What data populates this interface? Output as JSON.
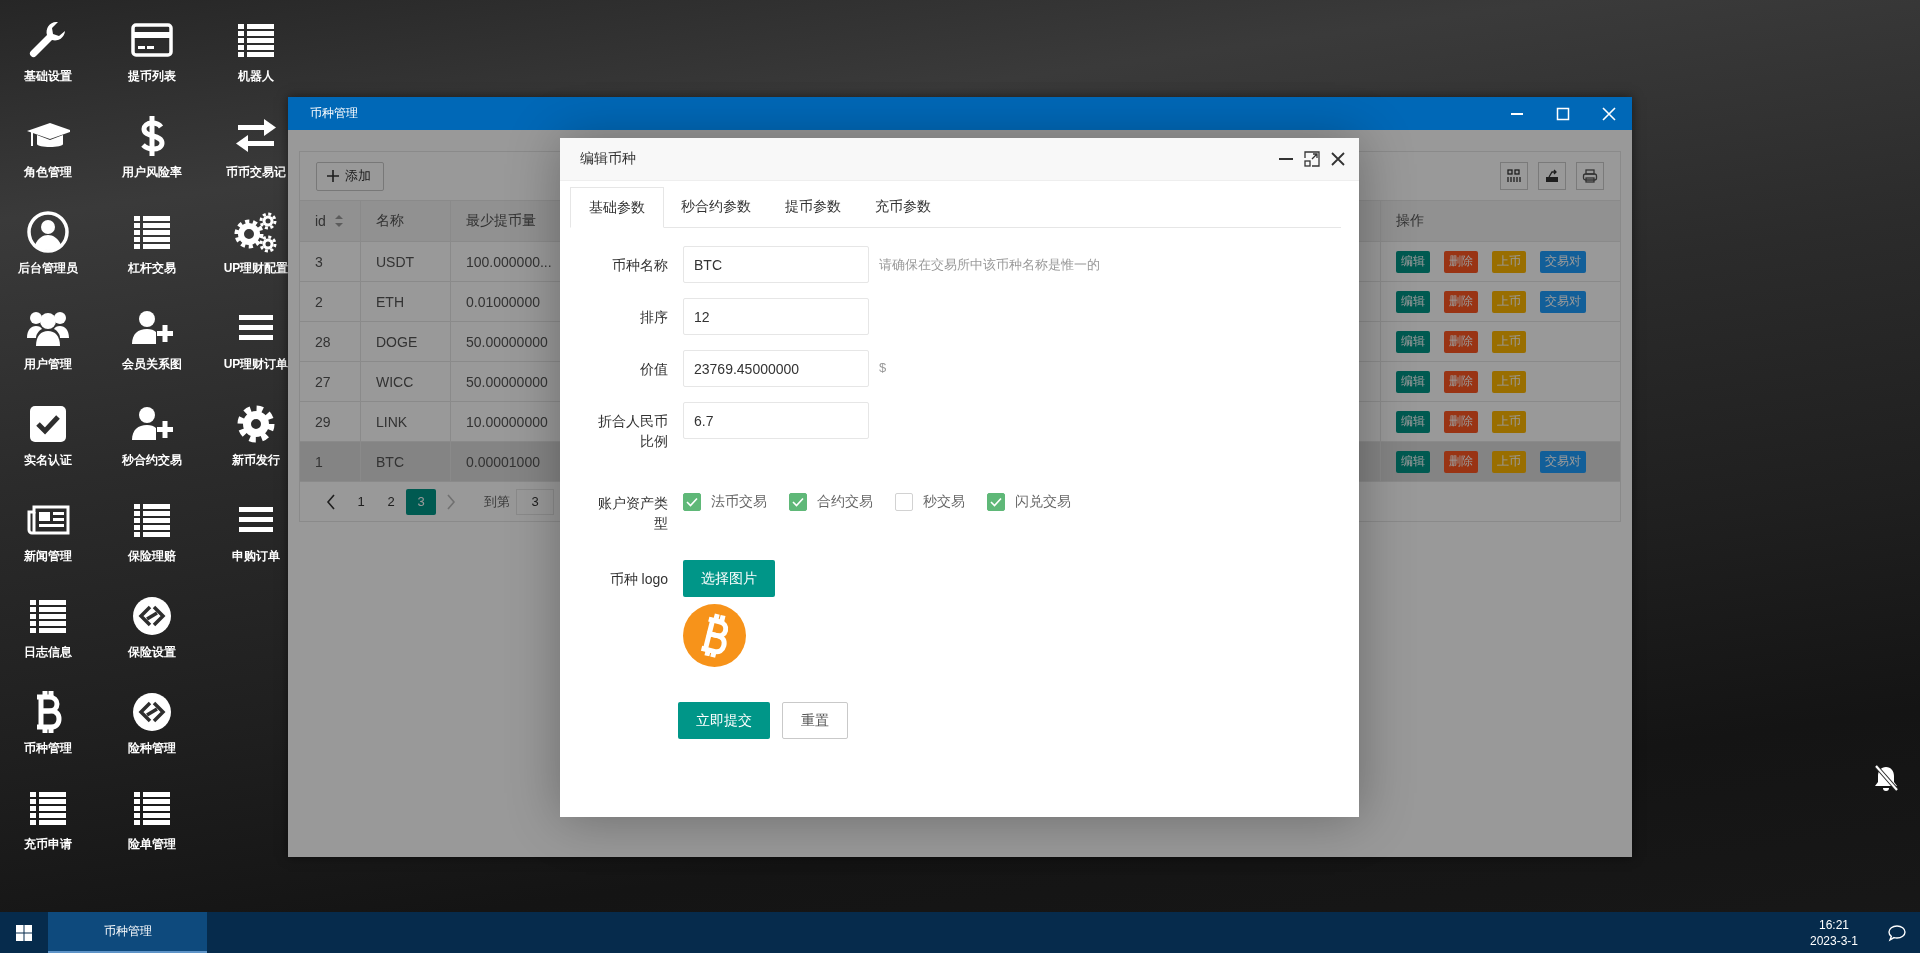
{
  "desktop_icons": [
    {
      "label": "基础设置"
    },
    {
      "label": "角色管理"
    },
    {
      "label": "后台管理员"
    },
    {
      "label": "用户管理"
    },
    {
      "label": "实名认证"
    },
    {
      "label": "新闻管理"
    },
    {
      "label": "日志信息"
    },
    {
      "label": "币种管理"
    },
    {
      "label": "充币申请"
    },
    {
      "label": "提币列表"
    },
    {
      "label": "用户风险率"
    },
    {
      "label": "杠杆交易"
    },
    {
      "label": "会员关系图"
    },
    {
      "label": "秒合约交易"
    },
    {
      "label": "保险理赔"
    },
    {
      "label": "保险设置"
    },
    {
      "label": "险种管理"
    },
    {
      "label": "险单管理"
    },
    {
      "label": "机器人"
    },
    {
      "label": "币币交易记"
    },
    {
      "label": "UP理财配置"
    },
    {
      "label": "UP理财订单"
    },
    {
      "label": "新币发行"
    },
    {
      "label": "申购订单"
    }
  ],
  "window": {
    "title": "币种管理",
    "toolbar": {
      "add_button": "添加"
    },
    "table": {
      "columns": [
        "id",
        "名称",
        "最少提币量",
        "操作"
      ],
      "rows": [
        {
          "id": "3",
          "name": "USDT",
          "min_withdraw": "100.000000...",
          "actions": [
            "编辑",
            "删除",
            "上币",
            "交易对"
          ],
          "selected": false
        },
        {
          "id": "2",
          "name": "ETH",
          "min_withdraw": "0.01000000",
          "actions": [
            "编辑",
            "删除",
            "上币",
            "交易对"
          ],
          "selected": false
        },
        {
          "id": "28",
          "name": "DOGE",
          "min_withdraw": "50.00000000",
          "actions": [
            "编辑",
            "删除",
            "上币"
          ],
          "selected": false
        },
        {
          "id": "27",
          "name": "WICC",
          "min_withdraw": "50.00000000",
          "actions": [
            "编辑",
            "删除",
            "上币"
          ],
          "selected": false
        },
        {
          "id": "29",
          "name": "LINK",
          "min_withdraw": "10.00000000",
          "actions": [
            "编辑",
            "删除",
            "上币"
          ],
          "selected": false
        },
        {
          "id": "1",
          "name": "BTC",
          "min_withdraw": "0.00001000",
          "actions": [
            "编辑",
            "删除",
            "上币",
            "交易对"
          ],
          "selected": true
        }
      ]
    },
    "pagination": {
      "pages": [
        {
          "label": "1",
          "selected": false
        },
        {
          "label": "2",
          "selected": false
        },
        {
          "label": "3",
          "selected": true
        }
      ],
      "goto_label": "到第",
      "goto_value": "3"
    }
  },
  "dialog": {
    "title": "编辑币种",
    "tabs": [
      {
        "label": "基础参数",
        "selected": true
      },
      {
        "label": "秒合约参数",
        "selected": false
      },
      {
        "label": "提币参数",
        "selected": false
      },
      {
        "label": "充币参数",
        "selected": false
      }
    ],
    "fields": [
      {
        "label": "币种名称",
        "value": "BTC",
        "hint": "请确保在交易所中该币种名称是惟一的"
      },
      {
        "label": "排序",
        "value": "12"
      },
      {
        "label": "价值",
        "value": "23769.45000000",
        "hint": "$"
      },
      {
        "label": "折合人民币比例",
        "value": "6.7"
      }
    ],
    "asset_types": {
      "label": "账户资产类型",
      "options": [
        {
          "label": "法币交易",
          "checked": true
        },
        {
          "label": "合约交易",
          "checked": true
        },
        {
          "label": "秒交易",
          "checked": false
        },
        {
          "label": "闪兑交易",
          "checked": true
        }
      ]
    },
    "logo": {
      "label": "币种 logo",
      "button": "选择图片"
    },
    "submit_button": "立即提交",
    "reset_button": "重置"
  },
  "taskbar": {
    "tasks": [
      {
        "label": "币种管理",
        "selected": true
      }
    ],
    "time": "16:21",
    "date": "2023-3-1"
  }
}
